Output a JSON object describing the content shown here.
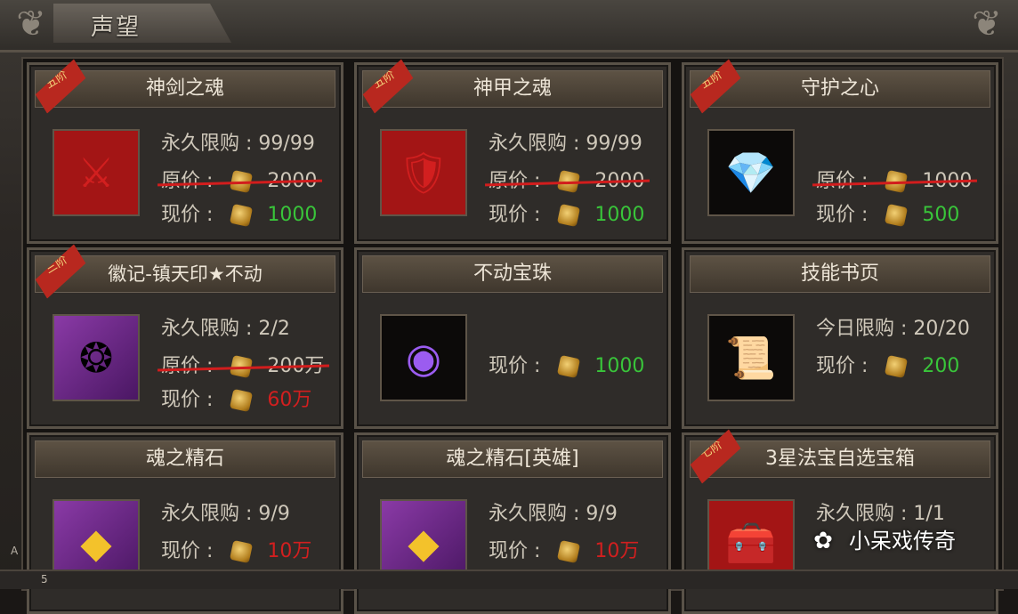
{
  "window": {
    "title": "声望"
  },
  "cards": [
    {
      "name": "神剑之魂",
      "badge": "五阶",
      "limit_label": "永久限购",
      "limit_value": "99/99",
      "orig_label": "原价",
      "orig_price": "2000",
      "curr_label": "现价",
      "curr_price": "1000",
      "curr_color": "green",
      "icon": "sword-soul-icon"
    },
    {
      "name": "神甲之魂",
      "badge": "五阶",
      "limit_label": "永久限购",
      "limit_value": "99/99",
      "orig_label": "原价",
      "orig_price": "2000",
      "curr_label": "现价",
      "curr_price": "1000",
      "curr_color": "green",
      "icon": "armor-soul-icon"
    },
    {
      "name": "守护之心",
      "badge": "五阶",
      "limit_label": "",
      "limit_value": "",
      "orig_label": "原价",
      "orig_price": "1000",
      "curr_label": "现价",
      "curr_price": "500",
      "curr_color": "green",
      "icon": "blue-gem-heart-icon"
    },
    {
      "name": "徽记-镇天印★不动",
      "badge": "三阶",
      "limit_label": "永久限购",
      "limit_value": "2/2",
      "orig_label": "原价",
      "orig_price": "200万",
      "curr_label": "现价",
      "curr_price": "60万",
      "curr_color": "red",
      "icon": "emblem-seal-icon"
    },
    {
      "name": "不动宝珠",
      "badge": "",
      "limit_label": "",
      "limit_value": "",
      "orig_label": "",
      "orig_price": "",
      "curr_label": "现价",
      "curr_price": "1000",
      "curr_color": "green",
      "icon": "purple-orb-icon"
    },
    {
      "name": "技能书页",
      "badge": "",
      "limit_label": "今日限购",
      "limit_value": "20/20",
      "orig_label": "",
      "orig_price": "",
      "curr_label": "现价",
      "curr_price": "200",
      "curr_color": "green",
      "icon": "skill-page-icon"
    },
    {
      "name": "魂之精石",
      "badge": "",
      "limit_label": "永久限购",
      "limit_value": "9/9",
      "orig_label": "",
      "orig_price": "",
      "curr_label": "现价",
      "curr_price": "10万",
      "curr_color": "red",
      "icon": "soul-crystal-icon"
    },
    {
      "name": "魂之精石[英雄]",
      "badge": "",
      "limit_label": "永久限购",
      "limit_value": "9/9",
      "orig_label": "",
      "orig_price": "",
      "curr_label": "现价",
      "curr_price": "10万",
      "curr_color": "red",
      "icon": "soul-crystal-hero-icon"
    },
    {
      "name": "3星法宝自选宝箱",
      "badge": "七阶",
      "limit_label": "永久限购",
      "limit_value": "1/1",
      "orig_label": "",
      "orig_price": "",
      "curr_label": "",
      "curr_price": "",
      "curr_color": "green",
      "icon": "treasure-chest-icon"
    }
  ],
  "watermark": {
    "text": "小呆戏传奇",
    "icon": "wechat-icon"
  },
  "bottom": {
    "text": "5",
    "side": "A"
  }
}
